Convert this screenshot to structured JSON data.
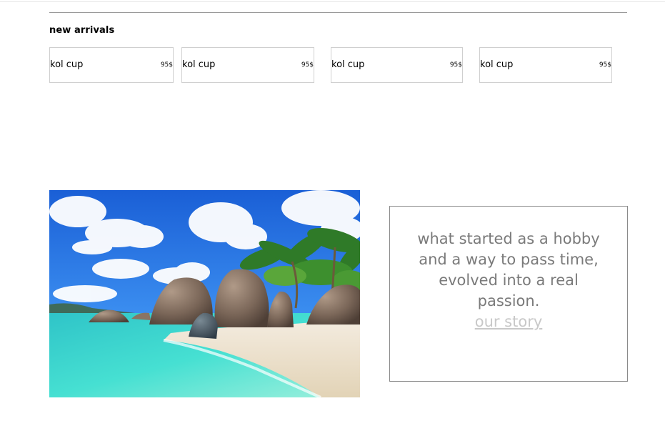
{
  "new_arrivals": {
    "title": "new arrivals",
    "products": [
      {
        "name": "kol cup",
        "price": "95$"
      },
      {
        "name": "kol cup",
        "price": "95$"
      },
      {
        "name": "kol cup",
        "price": "95$"
      },
      {
        "name": "kol cup",
        "price": "95$"
      }
    ]
  },
  "story": {
    "text": "what started as a hobby and a way to pass time, evolved into a real passion.",
    "link_label": "our story"
  },
  "hero": {
    "image_subject": "tropical beach with granite boulders and palm trees"
  }
}
